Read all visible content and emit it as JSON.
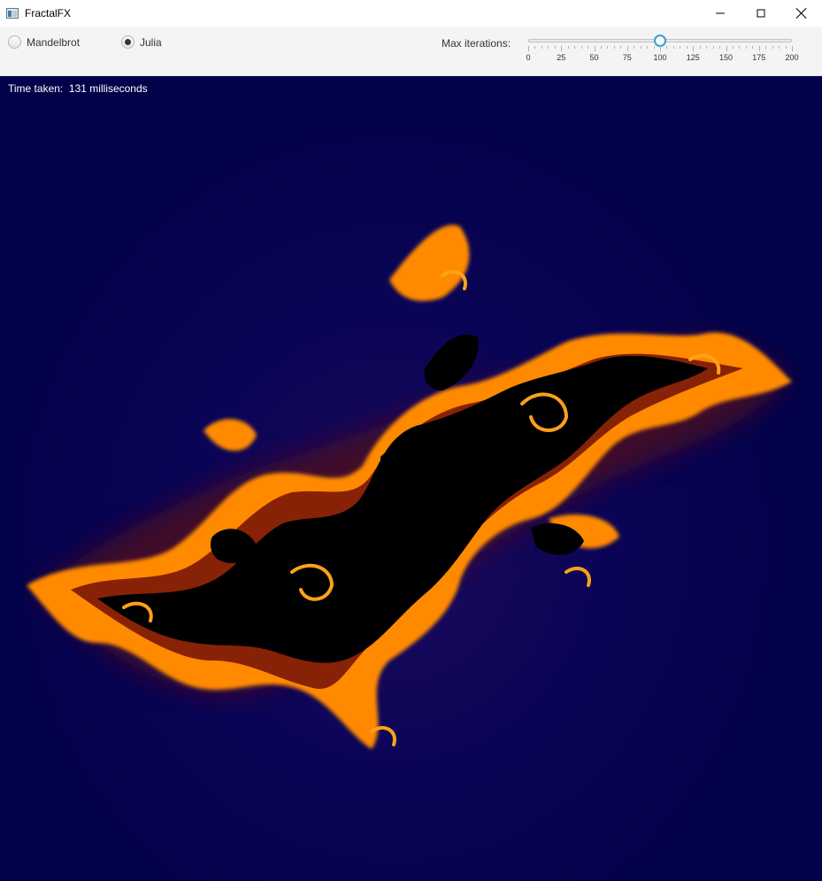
{
  "window": {
    "title": "FractalFX"
  },
  "toolbar": {
    "fractal_types": [
      {
        "label": "Mandelbrot",
        "selected": false
      },
      {
        "label": "Julia",
        "selected": true
      }
    ],
    "iterations": {
      "label": "Max iterations:",
      "value": 100,
      "min": 0,
      "max": 200,
      "tick_labels": [
        "0",
        "25",
        "50",
        "75",
        "100",
        "125",
        "150",
        "175",
        "200"
      ]
    }
  },
  "status": {
    "time_label": "Time taken:",
    "time_value": "131 milliseconds"
  },
  "colors": {
    "background": "#02024a",
    "interior": "#000000",
    "glow": "#5a0a0a",
    "edge": "#ff9900",
    "accent": "#3aa0d0"
  }
}
